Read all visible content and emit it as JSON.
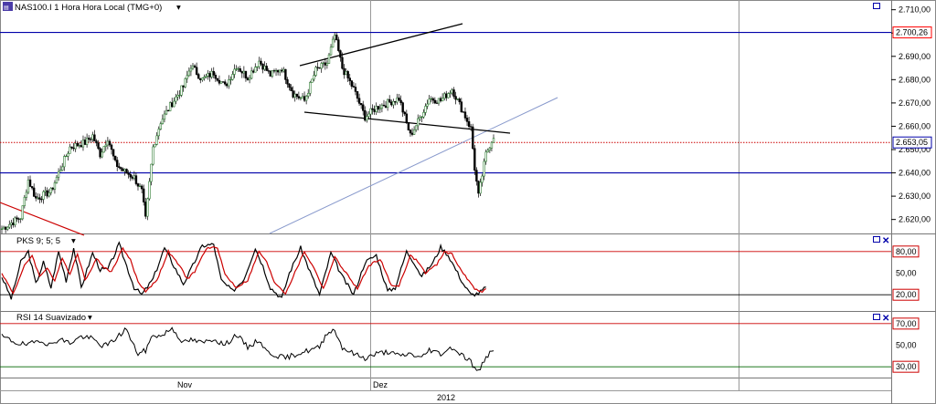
{
  "header": {
    "main_title": "NAS100.I 1 Hora Hora Local (TMG+0)",
    "pks_title": "PKS 9; 5; 5",
    "rsi_title": "RSI 14 Suavizado"
  },
  "colors": {
    "level_line": "#0000aa",
    "price_badge": "#0000aa",
    "level_badge_bg": "#ff0000",
    "bull_candle": "#2e7d32",
    "bear_candle": "#000000",
    "signal_line": "#cc0000",
    "oversold_line": "#006600",
    "trend_line": "#8899cc"
  },
  "chart_data": [
    {
      "type": "candlestick",
      "title": "NAS100.I 1 Hora Hora Local (TMG+0)",
      "y_ticks": [
        "2.710,00",
        "2.700,00",
        "2.690,00",
        "2.680,00",
        "2.670,00",
        "2.660,00",
        "2.650,00",
        "2.640,00",
        "2.630,00",
        "2.620,00"
      ],
      "y_tick_values": [
        2710,
        2700,
        2690,
        2680,
        2670,
        2660,
        2650,
        2640,
        2630,
        2620
      ],
      "ylim": [
        2614,
        2713
      ],
      "x_labels": [
        "Nov",
        "Dez"
      ],
      "x_year": "2012",
      "levels": [
        {
          "value": 2700.26,
          "label": "2.700,26",
          "style": "solid"
        },
        {
          "value": 2640,
          "label": "",
          "style": "solid"
        },
        {
          "value": 2653.05,
          "label": "2.653,05",
          "style": "dotted"
        }
      ],
      "close_series_anchors": [
        [
          0,
          2616
        ],
        [
          10,
          2621
        ],
        [
          14,
          2637
        ],
        [
          18,
          2629
        ],
        [
          26,
          2632
        ],
        [
          30,
          2640
        ],
        [
          36,
          2651
        ],
        [
          44,
          2653
        ],
        [
          48,
          2656
        ],
        [
          52,
          2648
        ],
        [
          56,
          2655
        ],
        [
          60,
          2644
        ],
        [
          64,
          2641
        ],
        [
          70,
          2638
        ],
        [
          74,
          2632
        ],
        [
          76,
          2620
        ],
        [
          80,
          2651
        ],
        [
          84,
          2662
        ],
        [
          90,
          2670
        ],
        [
          96,
          2677
        ],
        [
          100,
          2686
        ],
        [
          106,
          2680
        ],
        [
          112,
          2683
        ],
        [
          118,
          2677
        ],
        [
          124,
          2686
        ],
        [
          130,
          2681
        ],
        [
          136,
          2688
        ],
        [
          142,
          2682
        ],
        [
          148,
          2685
        ],
        [
          154,
          2674
        ],
        [
          160,
          2671
        ],
        [
          166,
          2684
        ],
        [
          172,
          2687
        ],
        [
          176,
          2699
        ],
        [
          180,
          2685
        ],
        [
          186,
          2676
        ],
        [
          192,
          2664
        ],
        [
          198,
          2668
        ],
        [
          204,
          2670
        ],
        [
          210,
          2672
        ],
        [
          216,
          2656
        ],
        [
          220,
          2662
        ],
        [
          226,
          2672
        ],
        [
          232,
          2671
        ],
        [
          238,
          2676
        ],
        [
          244,
          2666
        ],
        [
          248,
          2659
        ],
        [
          250,
          2642
        ],
        [
          252,
          2630
        ],
        [
          256,
          2648
        ],
        [
          260,
          2656
        ]
      ]
    },
    {
      "type": "line",
      "title": "PKS 9; 5; 5",
      "y_ticks": [
        "80,00",
        "50,00",
        "20,00"
      ],
      "y_tick_values": [
        80,
        50,
        20
      ],
      "ylim": [
        0,
        100
      ],
      "levels": [
        {
          "value": 80,
          "label": "80,00"
        },
        {
          "value": 20,
          "label": "20,00"
        }
      ],
      "series": [
        {
          "name": "",
          "anchors": [
            [
              0,
              45
            ],
            [
              5,
              15
            ],
            [
              10,
              65
            ],
            [
              14,
              80
            ],
            [
              18,
              35
            ],
            [
              22,
              65
            ],
            [
              26,
              30
            ],
            [
              30,
              80
            ],
            [
              34,
              40
            ],
            [
              38,
              85
            ],
            [
              42,
              30
            ],
            [
              48,
              78
            ],
            [
              52,
              55
            ],
            [
              56,
              55
            ],
            [
              62,
              90
            ],
            [
              66,
              60
            ],
            [
              70,
              30
            ],
            [
              74,
              20
            ],
            [
              80,
              42
            ],
            [
              86,
              85
            ],
            [
              92,
              55
            ],
            [
              96,
              35
            ],
            [
              100,
              55
            ],
            [
              106,
              88
            ],
            [
              112,
              90
            ],
            [
              116,
              40
            ],
            [
              122,
              25
            ],
            [
              128,
              42
            ],
            [
              134,
              85
            ],
            [
              138,
              60
            ],
            [
              142,
              30
            ],
            [
              148,
              15
            ],
            [
              152,
              50
            ],
            [
              158,
              85
            ],
            [
              164,
              45
            ],
            [
              168,
              20
            ],
            [
              174,
              78
            ],
            [
              180,
              45
            ],
            [
              186,
              20
            ],
            [
              192,
              65
            ],
            [
              198,
              75
            ],
            [
              204,
              25
            ],
            [
              208,
              30
            ],
            [
              214,
              80
            ],
            [
              218,
              65
            ],
            [
              222,
              45
            ],
            [
              228,
              65
            ],
            [
              232,
              86
            ],
            [
              236,
              75
            ],
            [
              240,
              55
            ],
            [
              244,
              35
            ],
            [
              248,
              20
            ],
            [
              252,
              22
            ],
            [
              256,
              30
            ]
          ]
        },
        {
          "name": "",
          "anchors": [
            [
              0,
              50
            ],
            [
              6,
              22
            ],
            [
              12,
              60
            ],
            [
              16,
              75
            ],
            [
              20,
              45
            ],
            [
              24,
              58
            ],
            [
              28,
              38
            ],
            [
              32,
              72
            ],
            [
              36,
              48
            ],
            [
              40,
              78
            ],
            [
              44,
              40
            ],
            [
              50,
              70
            ],
            [
              54,
              58
            ],
            [
              58,
              52
            ],
            [
              64,
              85
            ],
            [
              68,
              68
            ],
            [
              72,
              38
            ],
            [
              76,
              25
            ],
            [
              82,
              40
            ],
            [
              88,
              80
            ],
            [
              94,
              60
            ],
            [
              98,
              42
            ],
            [
              102,
              52
            ],
            [
              108,
              84
            ],
            [
              114,
              86
            ],
            [
              118,
              48
            ],
            [
              124,
              30
            ],
            [
              130,
              40
            ],
            [
              136,
              80
            ],
            [
              140,
              65
            ],
            [
              144,
              38
            ],
            [
              150,
              22
            ],
            [
              154,
              45
            ],
            [
              160,
              80
            ],
            [
              166,
              52
            ],
            [
              170,
              28
            ],
            [
              176,
              72
            ],
            [
              182,
              50
            ],
            [
              188,
              28
            ],
            [
              194,
              60
            ],
            [
              200,
              70
            ],
            [
              206,
              32
            ],
            [
              210,
              33
            ],
            [
              216,
              74
            ],
            [
              220,
              66
            ],
            [
              224,
              50
            ],
            [
              230,
              62
            ],
            [
              234,
              80
            ],
            [
              238,
              76
            ],
            [
              242,
              58
            ],
            [
              246,
              42
            ],
            [
              250,
              28
            ],
            [
              254,
              25
            ],
            [
              256,
              28
            ]
          ]
        }
      ]
    },
    {
      "type": "line",
      "title": "RSI 14 Suavizado",
      "y_ticks": [
        "70,00",
        "50,00",
        "30,00"
      ],
      "y_tick_values": [
        70,
        50,
        30
      ],
      "ylim": [
        20,
        80
      ],
      "levels": [
        {
          "value": 70,
          "label": "70,00"
        },
        {
          "value": 30,
          "label": "30,00"
        }
      ],
      "series": [
        {
          "name": "",
          "anchors": [
            [
              0,
              58
            ],
            [
              8,
              52
            ],
            [
              14,
              50
            ],
            [
              20,
              55
            ],
            [
              26,
              50
            ],
            [
              30,
              56
            ],
            [
              36,
              52
            ],
            [
              42,
              58
            ],
            [
              48,
              56
            ],
            [
              52,
              50
            ],
            [
              56,
              50
            ],
            [
              60,
              56
            ],
            [
              64,
              62
            ],
            [
              66,
              66
            ],
            [
              68,
              55
            ],
            [
              72,
              42
            ],
            [
              76,
              45
            ],
            [
              80,
              60
            ],
            [
              84,
              58
            ],
            [
              90,
              66
            ],
            [
              96,
              52
            ],
            [
              100,
              55
            ],
            [
              106,
              52
            ],
            [
              112,
              56
            ],
            [
              118,
              50
            ],
            [
              124,
              60
            ],
            [
              130,
              48
            ],
            [
              136,
              55
            ],
            [
              140,
              44
            ],
            [
              146,
              40
            ],
            [
              150,
              38
            ],
            [
              156,
              42
            ],
            [
              162,
              45
            ],
            [
              168,
              48
            ],
            [
              172,
              62
            ],
            [
              176,
              64
            ],
            [
              180,
              48
            ],
            [
              186,
              42
            ],
            [
              192,
              38
            ],
            [
              198,
              42
            ],
            [
              204,
              44
            ],
            [
              210,
              40
            ],
            [
              216,
              42
            ],
            [
              222,
              38
            ],
            [
              226,
              46
            ],
            [
              232,
              42
            ],
            [
              238,
              48
            ],
            [
              244,
              40
            ],
            [
              248,
              35
            ],
            [
              250,
              28
            ],
            [
              252,
              25
            ],
            [
              256,
              40
            ],
            [
              260,
              44
            ]
          ]
        }
      ]
    }
  ]
}
